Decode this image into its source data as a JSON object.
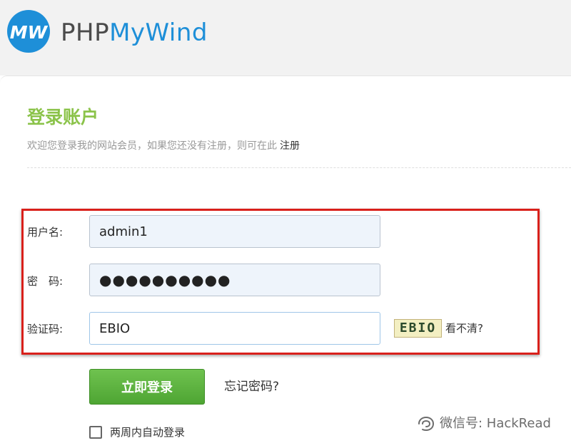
{
  "header": {
    "logo_part1": "PHP",
    "logo_part2": "MyWind"
  },
  "login": {
    "title": "登录账户",
    "subtitle": "欢迎您登录我的网站会员，如果您还没有注册，则可在此",
    "register_link": "注册",
    "username_label": "用户名:",
    "username_value": "admin1",
    "password_label": "密　码:",
    "password_value": "●●●●●●●●●●",
    "captcha_label": "验证码:",
    "captcha_value": "EBIO",
    "captcha_image_text": "EBIO",
    "captcha_refresh": "看不清?",
    "submit_label": "立即登录",
    "forgot_link": "忘记密码?",
    "remember_label": "两周内自动登录",
    "remember_checked": false
  },
  "watermark": {
    "text": "微信号: HackRead"
  },
  "colors": {
    "brand_blue": "#1e8fd8",
    "title_green": "#8bc34a",
    "button_green": "#5cb33d",
    "highlight_red": "#d9201b"
  },
  "icons": {
    "logo": "mywind-logo-icon",
    "watermark": "wechat-icon"
  }
}
